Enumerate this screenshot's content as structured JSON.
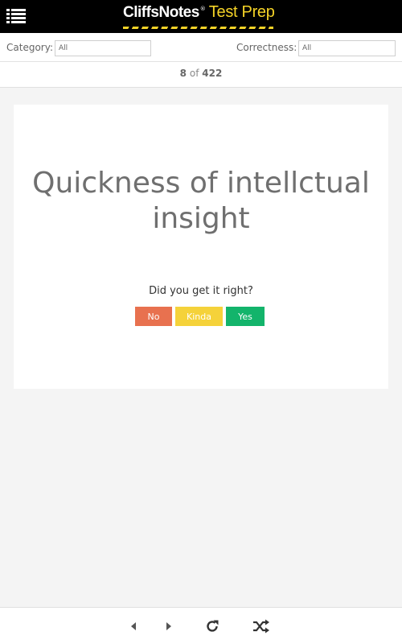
{
  "header": {
    "brand": "CliffsNotes",
    "registered": "®",
    "subtitle": "Test Prep",
    "menu_icon": "list-menu-icon",
    "brand_color": "#f5d327"
  },
  "filters": {
    "category_label": "Category:",
    "category_value": "All",
    "correctness_label": "Correctness:",
    "correctness_value": "All"
  },
  "counter": {
    "current": "8",
    "of": "of",
    "total": "422"
  },
  "card": {
    "term": "Quickness of intellctual insight",
    "question": "Did you get it right?",
    "buttons": {
      "no": "No",
      "kinda": "Kinda",
      "yes": "Yes"
    },
    "colors": {
      "no": "#e8714f",
      "kinda": "#f5d23a",
      "yes": "#13b46b"
    }
  },
  "toolbar": {
    "icons": [
      "prev-icon",
      "next-icon",
      "refresh-icon",
      "shuffle-icon"
    ]
  }
}
